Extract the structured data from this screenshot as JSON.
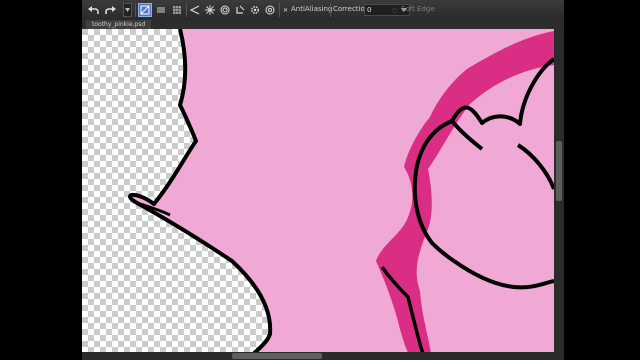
{
  "toolbar": {
    "antialiasing_label": "AntiAliasing",
    "correction_label": "Correction",
    "correction_value": "0",
    "soft_edge_label": "Soft Edge",
    "antialiasing_checked": true,
    "soft_edge_checked": false
  },
  "document": {
    "tab_title": "toothy_pinkie.psd"
  },
  "colors": {
    "mane_fill": "#f0a8d4",
    "dark_pink": "#d92e84",
    "outline": "#000000",
    "toolbar_bg": "#333333",
    "active_tool": "#4f79c8"
  },
  "icons": [
    "undo-icon",
    "redo-icon",
    "dropdown-icon",
    "selection-mode-icon",
    "layers-mode-icon",
    "grid-mode-icon",
    "lasso-icon",
    "starburst-icon",
    "circle-target-icon",
    "fill-icon",
    "gear-icon",
    "settings-icon"
  ]
}
